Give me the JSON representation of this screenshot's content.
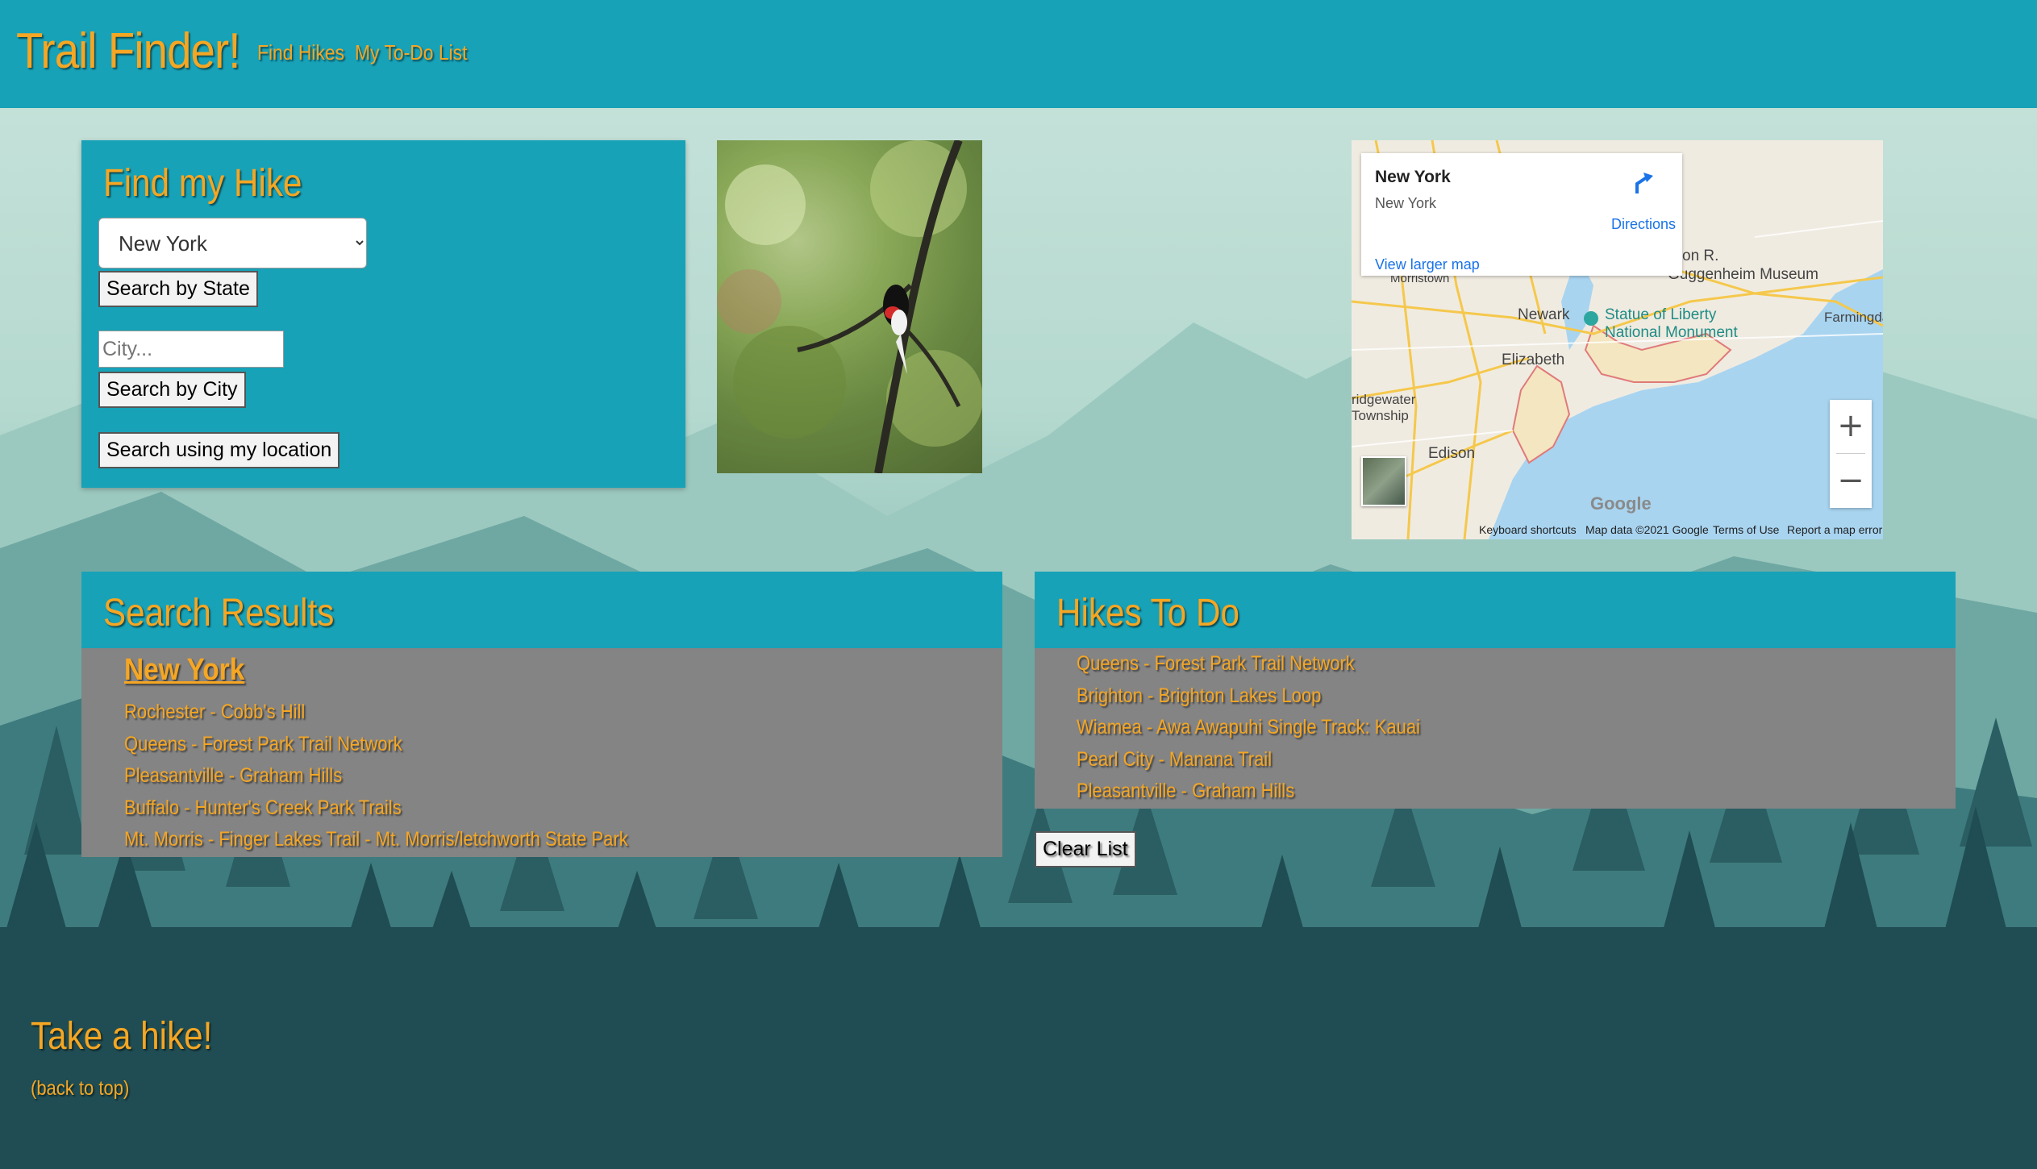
{
  "header": {
    "brand": "Trail Finder!",
    "nav": [
      "Find Hikes",
      "My To-Do List"
    ]
  },
  "find_panel": {
    "title": "Find my Hike",
    "state_selected": "New York",
    "search_state_label": "Search by State",
    "city_placeholder": "City...",
    "search_city_label": "Search by City",
    "search_location_label": "Search using my location"
  },
  "map": {
    "card_title": "New York",
    "card_subtitle": "New York",
    "view_larger": "View larger map",
    "directions": "Directions",
    "labels": [
      "Newark",
      "Statue of Liberty",
      "National Monument",
      "Elizabeth",
      "Edison",
      "Farmingdale",
      "Morristown",
      "ridgewater",
      "Township",
      "Guggenheim Museum",
      "on R."
    ],
    "zoom_in": "+",
    "zoom_out": "−",
    "footer": [
      "Keyboard shortcuts",
      "Map data ©2021 Google",
      "Terms of Use",
      "Report a map error"
    ],
    "google": "Google"
  },
  "results": {
    "title": "Search Results",
    "heading": "New York",
    "items": [
      "Rochester - Cobb's Hill",
      "Queens - Forest Park Trail Network",
      "Pleasantville - Graham Hills",
      "Buffalo - Hunter's Creek Park Trails",
      "Mt. Morris - Finger Lakes Trail - Mt. Morris/letchworth State Park"
    ]
  },
  "todo": {
    "title": "Hikes To Do",
    "items": [
      "Queens - Forest Park Trail Network",
      "Brighton - Brighton Lakes Loop",
      "Wiamea - Awa Awapuhi Single Track: Kauai",
      "Pearl City - Manana Trail",
      "Pleasantville - Graham Hills"
    ],
    "clear_label": "Clear List"
  },
  "footer": {
    "title": "Take a hike!",
    "back_link": "(back to top)"
  },
  "colors": {
    "accent": "#f5a623",
    "header_bg": "#17a2b8",
    "list_bg": "#848484"
  }
}
